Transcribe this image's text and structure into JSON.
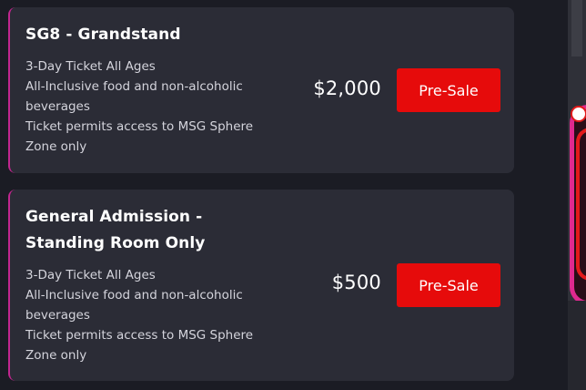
{
  "tickets": [
    {
      "title": "SG8 - Grandstand",
      "features": [
        "3-Day Ticket All Ages",
        "All-Inclusive food and non-alcoholic beverages",
        "Ticket permits access to MSG Sphere Zone only"
      ],
      "price": "$2,000",
      "button_label": "Pre-Sale"
    },
    {
      "title": "General Admission - Standing Room Only",
      "features": [
        "3-Day Ticket All Ages",
        "All-Inclusive food and non-alcoholic beverages",
        "Ticket permits access to MSG Sphere Zone only"
      ],
      "price": "$500",
      "button_label": "Pre-Sale"
    }
  ],
  "colors": {
    "background": "#1b1c24",
    "card": "#2b2c36",
    "accent_border": "#c2268f",
    "button": "#e60b0b"
  }
}
